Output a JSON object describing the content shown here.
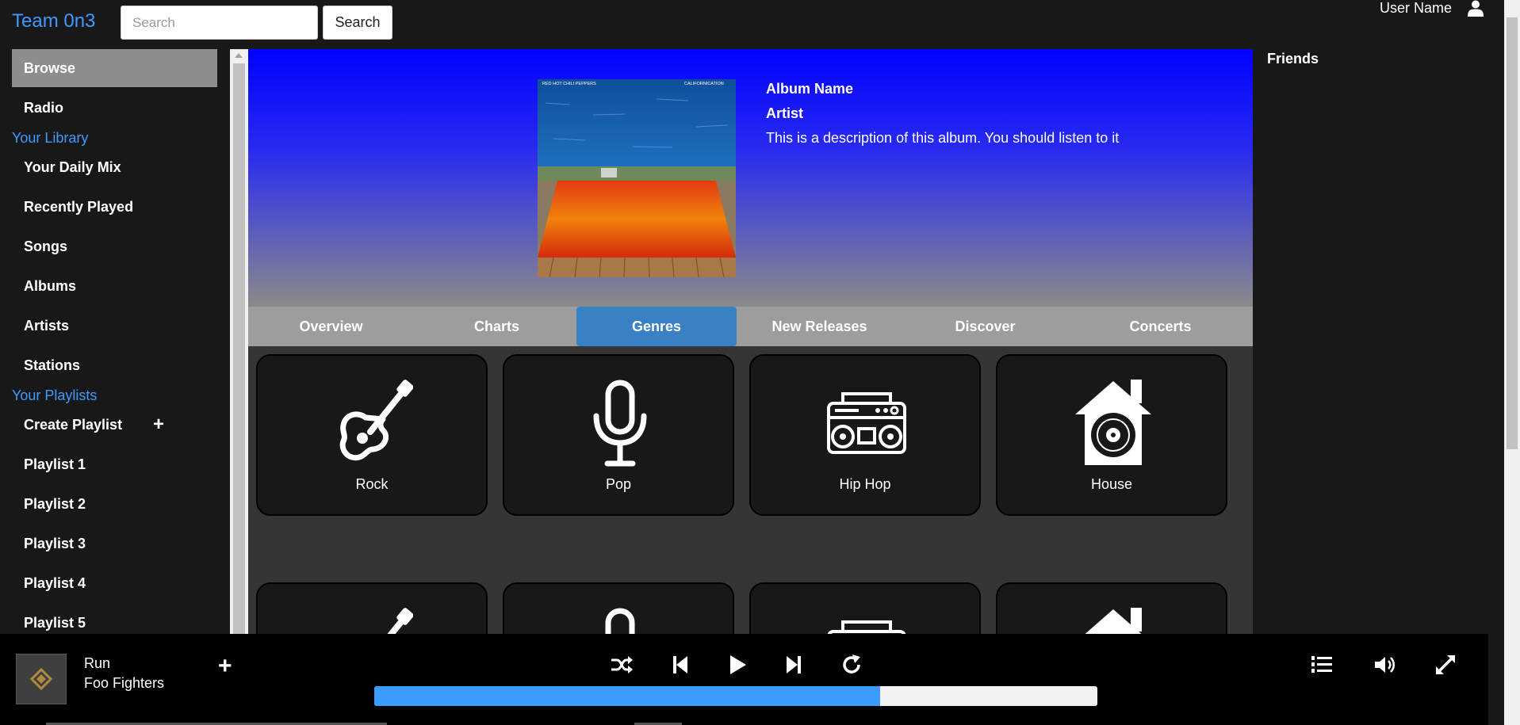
{
  "header": {
    "brand": "Team 0n3",
    "search_placeholder": "Search",
    "search_button": "Search",
    "user_name": "User Name"
  },
  "sidebar": {
    "browse": "Browse",
    "radio": "Radio",
    "library_heading": "Your Library",
    "library": [
      "Your Daily Mix",
      "Recently Played",
      "Songs",
      "Albums",
      "Artists",
      "Stations"
    ],
    "playlists_heading": "Your Playlists",
    "create_playlist": "Create Playlist",
    "playlists": [
      "Playlist 1",
      "Playlist 2",
      "Playlist 3",
      "Playlist 4",
      "Playlist 5"
    ]
  },
  "hero": {
    "album_name": "Album Name",
    "artist": "Artist",
    "description": "This is a description of this album. You should listen to it",
    "cover_text_left": "RED HOT CHILI PEPPERS",
    "cover_text_right": "CALIFORNICATION"
  },
  "tabs": [
    "Overview",
    "Charts",
    "Genres",
    "New Releases",
    "Discover",
    "Concerts"
  ],
  "active_tab": "Genres",
  "genres": [
    {
      "label": "Rock",
      "icon": "guitar-icon"
    },
    {
      "label": "Pop",
      "icon": "microphone-icon"
    },
    {
      "label": "Hip Hop",
      "icon": "boombox-icon"
    },
    {
      "label": "House",
      "icon": "house-record-icon"
    }
  ],
  "friends": {
    "title": "Friends"
  },
  "player": {
    "track_title": "Run",
    "track_artist": "Foo Fighters",
    "progress": 0.7,
    "icons": [
      "shuffle-icon",
      "previous-icon",
      "play-icon",
      "next-icon",
      "repeat-icon",
      "queue-icon",
      "volume-icon",
      "fullscreen-icon"
    ]
  },
  "colors": {
    "accent": "#3d9bff",
    "active_tab": "#3a80c4",
    "background": "#181818",
    "content": "#353535"
  }
}
